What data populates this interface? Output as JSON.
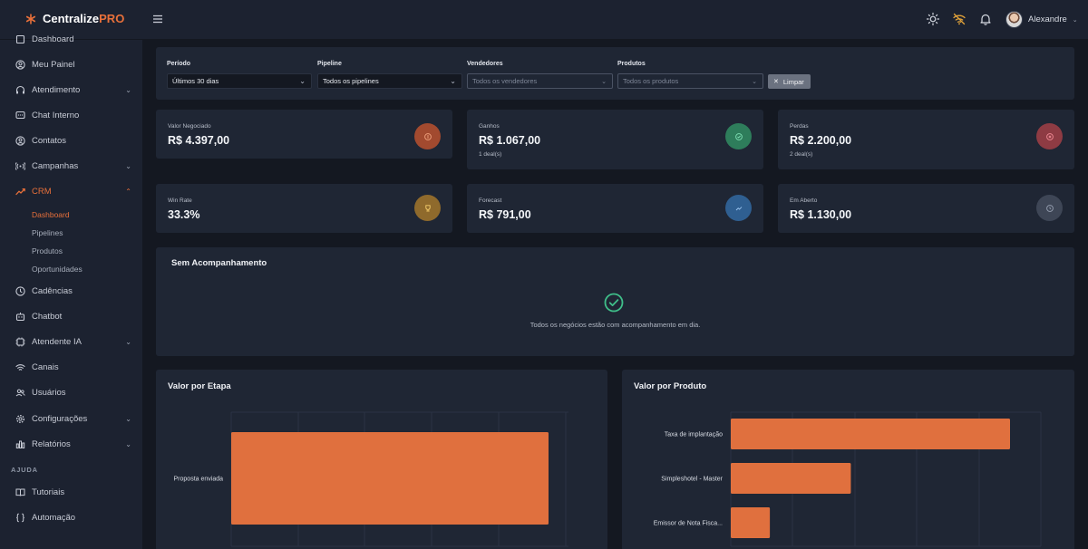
{
  "brand": {
    "name": "Centralize",
    "suffix": "PRO"
  },
  "topbar": {
    "user_name": "Alexandre"
  },
  "sidebar": {
    "items": [
      {
        "label": "Dashboard",
        "icon": "dashboard-icon"
      },
      {
        "label": "Meu Painel",
        "icon": "user-circle-icon"
      },
      {
        "label": "Atendimento",
        "icon": "headset-icon",
        "has_children": true
      },
      {
        "label": "Chat Interno",
        "icon": "chat-icon"
      },
      {
        "label": "Contatos",
        "icon": "contact-icon"
      },
      {
        "label": "Campanhas",
        "icon": "broadcast-icon",
        "has_children": true
      },
      {
        "label": "CRM",
        "icon": "trend-icon",
        "has_children": true,
        "active": true
      },
      {
        "label": "Cadências",
        "icon": "clock-icon"
      },
      {
        "label": "Chatbot",
        "icon": "bot-icon"
      },
      {
        "label": "Atendente IA",
        "icon": "ai-icon",
        "has_children": true
      },
      {
        "label": "Canais",
        "icon": "wifi-icon"
      },
      {
        "label": "Usuários",
        "icon": "users-icon"
      },
      {
        "label": "Configurações",
        "icon": "gear-icon",
        "has_children": true
      },
      {
        "label": "Relatórios",
        "icon": "bar-chart-icon",
        "has_children": true
      }
    ],
    "crm_children": [
      {
        "label": "Dashboard",
        "active": true
      },
      {
        "label": "Pipelines"
      },
      {
        "label": "Produtos"
      },
      {
        "label": "Oportunidades"
      }
    ],
    "help_section": "AJUDA",
    "help_items": [
      {
        "label": "Tutoriais",
        "icon": "book-icon"
      },
      {
        "label": "Automação",
        "icon": "braces-icon"
      }
    ]
  },
  "filters": {
    "periodo": {
      "label": "Período",
      "value": "Últimos 30 dias"
    },
    "pipeline": {
      "label": "Pipeline",
      "value": "Todos os pipelines"
    },
    "vendedores": {
      "label": "Vendedores",
      "placeholder": "Todos os vendedores"
    },
    "produtos": {
      "label": "Produtos",
      "placeholder": "Todos os produtos"
    },
    "clear_label": "Limpar"
  },
  "stats": [
    {
      "label": "Valor Negociado",
      "value": "R$ 4.397,00",
      "sub": "",
      "icon": "money-icon",
      "color": "#a24a2f"
    },
    {
      "label": "Ganhos",
      "value": "R$ 1.067,00",
      "sub": "1 deal(s)",
      "icon": "check-icon",
      "color": "#2e7d5b"
    },
    {
      "label": "Perdas",
      "value": "R$ 2.200,00",
      "sub": "2 deal(s)",
      "icon": "x-circle-icon",
      "color": "#8e3b43"
    },
    {
      "label": "Win Rate",
      "value": "33.3%",
      "sub": "",
      "icon": "trophy-icon",
      "color": "#8f6a2c"
    },
    {
      "label": "Forecast",
      "value": "R$ 791,00",
      "sub": "",
      "icon": "trend-up-icon",
      "color": "#2f5f91"
    },
    {
      "label": "Em Aberto",
      "value": "R$ 1.130,00",
      "sub": "",
      "icon": "clock-icon",
      "color": "#3e4656"
    }
  ],
  "sem_acompanhamento": {
    "title": "Sem Acompanhamento",
    "message": "Todos os negócios estão com acompanhamento em dia."
  },
  "chart_data": [
    {
      "type": "bar",
      "orientation": "horizontal",
      "title": "Valor por Etapa",
      "categories": [
        "Proposta enviada"
      ],
      "values": [
        100
      ],
      "color": "#e0703e",
      "grid": true
    },
    {
      "type": "bar",
      "orientation": "horizontal",
      "title": "Valor por Produto",
      "categories": [
        "Taxa de implantação",
        "Simpleshotel - Master",
        "Emissor de Nota Fisca..."
      ],
      "values": [
        100,
        43,
        14
      ],
      "color": "#e0703e",
      "grid": true
    }
  ]
}
